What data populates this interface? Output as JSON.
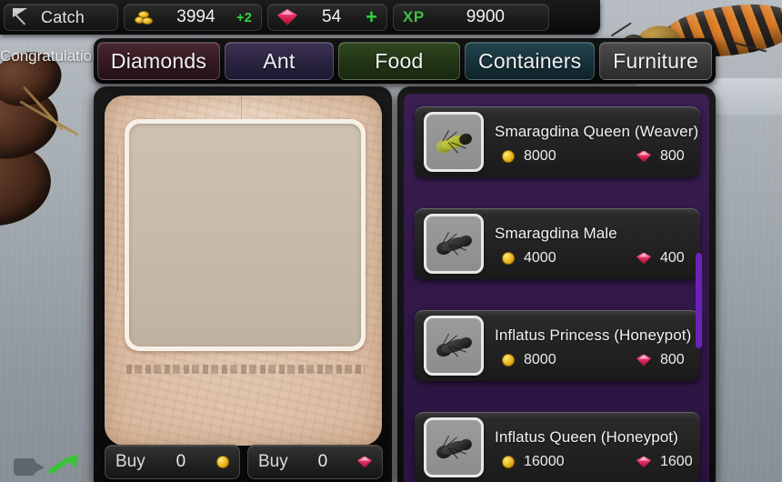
{
  "hud": {
    "catch_label": "Catch",
    "catch_icon": "net-icon",
    "gold_icon": "coins-icon",
    "gold_amount": "3994",
    "gold_delta": "+2",
    "gem_icon": "diamond-icon",
    "gem_amount": "54",
    "gem_plus": "+",
    "xp_label": "XP",
    "xp_amount": "9900"
  },
  "overlay": {
    "congrats_text": "Congratulations",
    "camera_icon": "video-camera-icon",
    "share_icon": "green-arrow-icon"
  },
  "tabs": [
    {
      "label": "Diamonds",
      "key": "diamonds",
      "color": "#33191f",
      "active": false
    },
    {
      "label": "Ant",
      "key": "ant",
      "color": "#2a2340",
      "active": true
    },
    {
      "label": "Food",
      "key": "food",
      "color": "#223515",
      "active": false
    },
    {
      "label": "Containers",
      "key": "containers",
      "color": "#17323a",
      "active": false
    },
    {
      "label": "Furniture",
      "key": "furniture",
      "color": "#3a3a3a",
      "active": false
    }
  ],
  "detail": {
    "preview_placeholder": "",
    "description_text": "",
    "buy_gold": {
      "label": "Buy",
      "quantity": "0",
      "currency_icon": "coin-icon"
    },
    "buy_gem": {
      "label": "Buy",
      "quantity": "0",
      "currency_icon": "diamond-icon"
    }
  },
  "shop_list": {
    "scroll_thumb_color": "#6b22b8",
    "items": [
      {
        "name": "Smaragdina Queen (Weaver)",
        "gold_cost": "8000",
        "gem_cost": "800",
        "thumb": "green-weaver-ant",
        "thumb_class": "green"
      },
      {
        "name": "Smaragdina Male",
        "gold_cost": "4000",
        "gem_cost": "400",
        "thumb": "black-ant",
        "thumb_class": "black"
      },
      {
        "name": "Inflatus Princess (Honeypot)",
        "gold_cost": "8000",
        "gem_cost": "800",
        "thumb": "black-ant",
        "thumb_class": "black"
      },
      {
        "name": "Inflatus Queen (Honeypot)",
        "gold_cost": "16000",
        "gem_cost": "1600",
        "thumb": "black-ant",
        "thumb_class": "black"
      }
    ]
  }
}
